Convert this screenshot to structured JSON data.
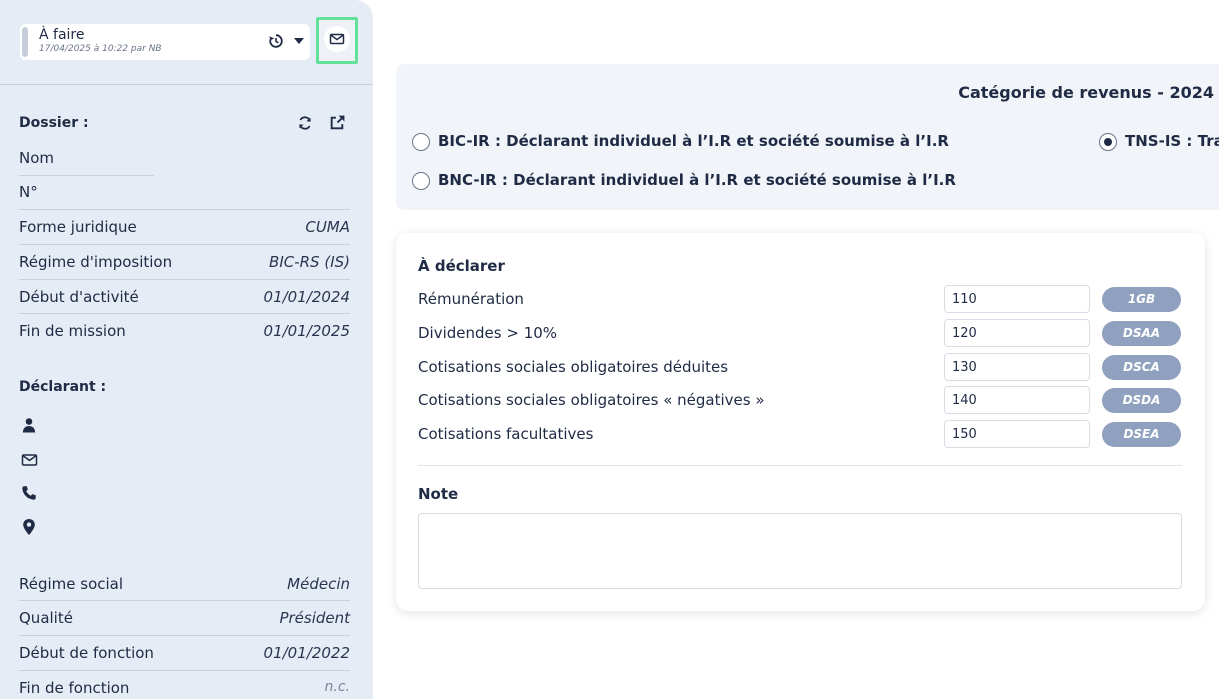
{
  "status": {
    "label": "À faire",
    "subtext": "17/04/2025 à 10:22 par NB",
    "history_icon": "history-icon",
    "dropdown_icon": "caret-down-icon",
    "mail_icon": "mail-icon"
  },
  "dossier": {
    "title": "Dossier :",
    "refresh_icon": "refresh-icon",
    "open_icon": "external-link-icon",
    "rows": [
      {
        "label": "Nom",
        "value": ""
      },
      {
        "label": "N°",
        "value": ""
      },
      {
        "label": "Forme juridique",
        "value": "CUMA"
      },
      {
        "label": "Régime d'imposition",
        "value": "BIC-RS (IS)"
      },
      {
        "label": "Début d'activité",
        "value": "01/01/2024"
      },
      {
        "label": "Fin de mission",
        "value": "01/01/2025"
      }
    ]
  },
  "declarant": {
    "title": "Déclarant :",
    "icons": [
      "user-icon",
      "mail-icon",
      "phone-icon",
      "location-icon"
    ],
    "rows": [
      {
        "label": "Régime social",
        "value": "Médecin"
      },
      {
        "label": "Qualité",
        "value": "Président"
      },
      {
        "label": "Début de fonction",
        "value": "01/01/2022"
      },
      {
        "label": "Fin de fonction",
        "value": "n.c."
      }
    ]
  },
  "category": {
    "title": "Catégorie de revenus - 2024",
    "options": [
      {
        "label": "BIC-IR : Déclarant individuel à l’I.R et société soumise à l’I.R",
        "checked": false
      },
      {
        "label": "TNS-IS : Tra",
        "checked": true
      },
      {
        "label": "BNC-IR : Déclarant individuel à l’I.R et société soumise à l’I.R",
        "checked": false
      }
    ]
  },
  "declare": {
    "title": "À déclarer",
    "items": [
      {
        "label": "Rémunération",
        "value": "110",
        "code": "1GB"
      },
      {
        "label": "Dividendes > 10%",
        "value": "120",
        "code": "DSAA"
      },
      {
        "label": "Cotisations sociales obligatoires déduites",
        "value": "130",
        "code": "DSCA"
      },
      {
        "label": "Cotisations sociales obligatoires « négatives »",
        "value": "140",
        "code": "DSDA"
      },
      {
        "label": "Cotisations facultatives",
        "value": "150",
        "code": "DSEA"
      }
    ],
    "note_title": "Note",
    "note_value": ""
  },
  "colors": {
    "sidebar_bg": "#e6ecf5",
    "highlight": "#62e19a",
    "code_badge": "#8fa1bf",
    "text": "#1f2a44"
  }
}
